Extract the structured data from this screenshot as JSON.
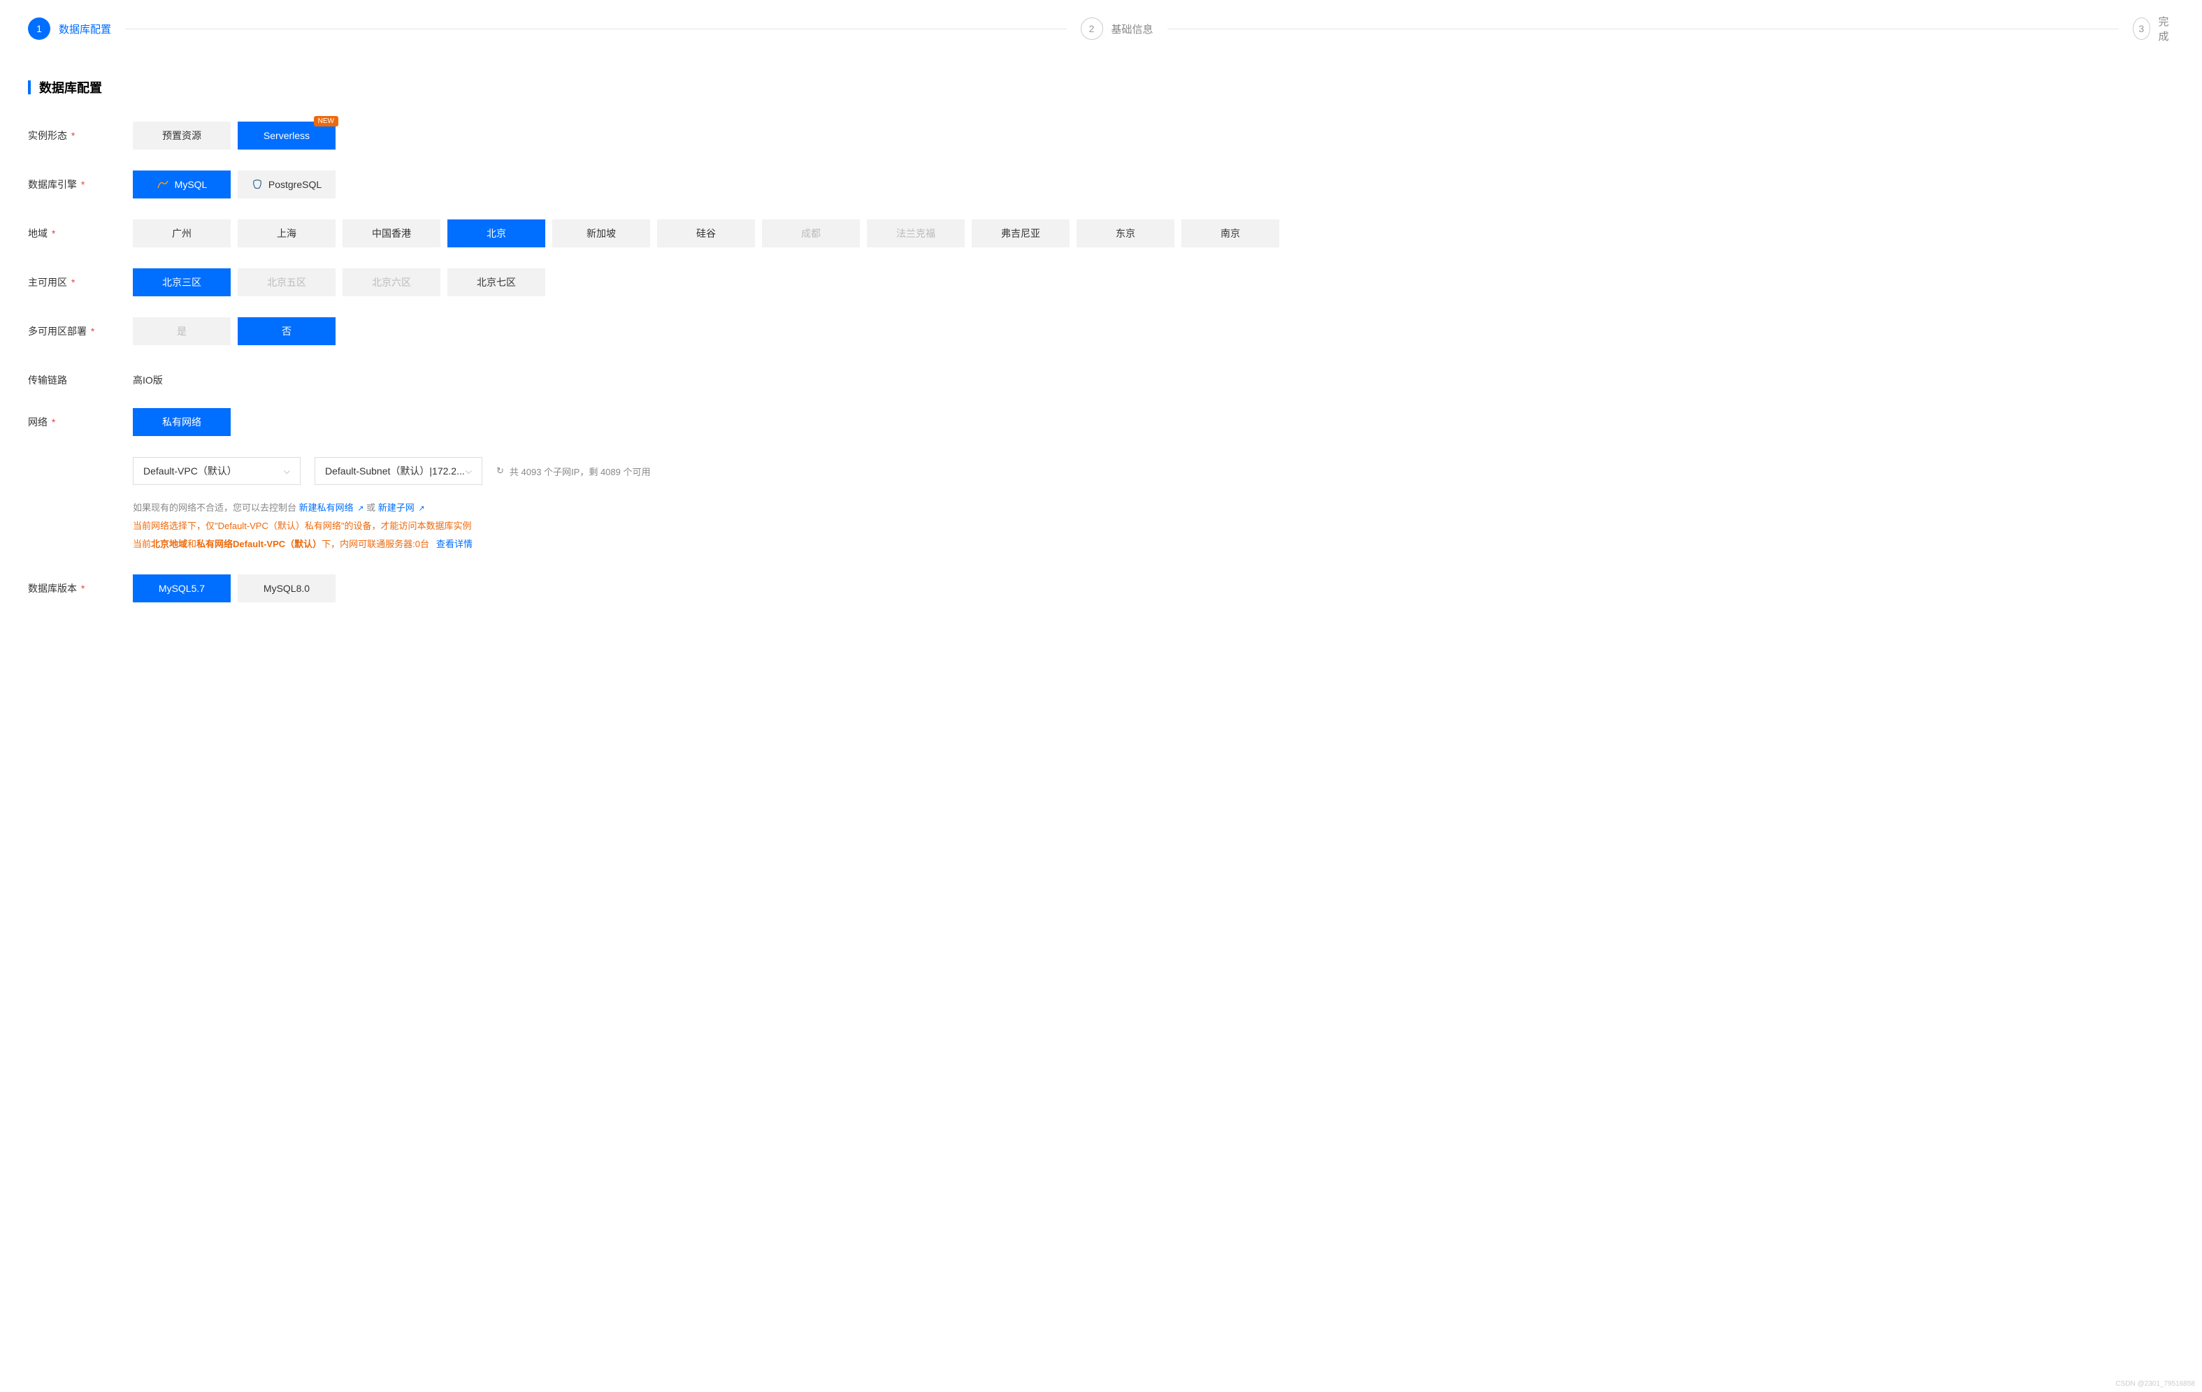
{
  "steps": {
    "s1": {
      "num": "1",
      "label": "数据库配置"
    },
    "s2": {
      "num": "2",
      "label": "基础信息"
    },
    "s3": {
      "num": "3",
      "label": "完成"
    }
  },
  "section_title": "数据库配置",
  "labels": {
    "instance_type": "实例形态",
    "db_engine": "数据库引擎",
    "region": "地域",
    "az": "主可用区",
    "multi_az": "多可用区部署",
    "transport": "传输链路",
    "network": "网络",
    "db_version": "数据库版本"
  },
  "instance_type": {
    "preset": "预置资源",
    "serverless": "Serverless",
    "badge": "NEW"
  },
  "db_engine": {
    "mysql": "MySQL",
    "postgresql": "PostgreSQL"
  },
  "regions": {
    "gz": "广州",
    "sh": "上海",
    "hk": "中国香港",
    "bj": "北京",
    "sg": "新加坡",
    "sv": "硅谷",
    "cd": "成都",
    "fra": "法兰克福",
    "va": "弗吉尼亚",
    "tk": "东京",
    "nj": "南京"
  },
  "az": {
    "bj3": "北京三区",
    "bj5": "北京五区",
    "bj6": "北京六区",
    "bj7": "北京七区"
  },
  "multi_az": {
    "yes": "是",
    "no": "否"
  },
  "transport_value": "高IO版",
  "network": {
    "private": "私有网络",
    "vpc_select": "Default-VPC（默认）",
    "subnet_select": "Default-Subnet（默认）|172.2...",
    "refresh_info": "共 4093 个子网IP，剩 4089 个可用",
    "hint_prefix": "如果现有的网络不合适，您可以去控制台 ",
    "link1": "新建私有网络",
    "hint_or": " 或 ",
    "link2": "新建子网",
    "warn1_prefix": "当前网络选择下，仅\"Default-VPC（默认）私有网络\"的设备，才能访问本数据库实例",
    "warn2_prefix": "当前",
    "warn2_bold1": "北京地域",
    "warn2_mid": "和",
    "warn2_bold2": "私有网络Default-VPC（默认）",
    "warn2_suffix": "下，内网可联通服务器:0台",
    "warn2_link": "查看详情"
  },
  "db_version": {
    "v57": "MySQL5.7",
    "v80": "MySQL8.0"
  },
  "watermark": "CSDN @2301_79516858"
}
